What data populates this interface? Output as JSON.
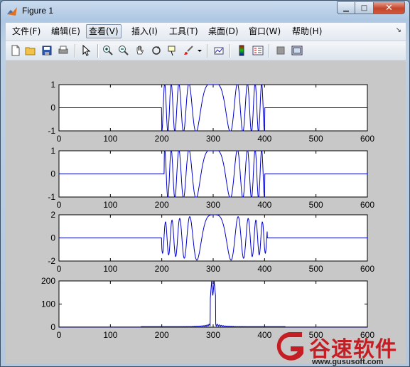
{
  "window": {
    "title": "Figure 1",
    "buttons": {
      "minimize": "▁",
      "maximize": "□",
      "close": "✕"
    }
  },
  "menubar": {
    "items": [
      {
        "label": "文件(F)"
      },
      {
        "label": "编辑(E)"
      },
      {
        "label": "查看(V)"
      },
      {
        "label": "插入(I)"
      },
      {
        "label": "工具(T)"
      },
      {
        "label": "桌面(D)"
      },
      {
        "label": "窗口(W)"
      },
      {
        "label": "帮助(H)"
      }
    ],
    "active_item": "查看(V)"
  },
  "toolbar": {
    "icons": [
      "new-figure-icon",
      "open-file-icon",
      "save-icon",
      "print-icon",
      "pointer-icon",
      "zoom-in-icon",
      "zoom-out-icon",
      "pan-hand-icon",
      "rotate-3d-icon",
      "data-cursor-icon",
      "brush-icon",
      "brush-dropdown-icon",
      "link-plot-icon",
      "colorbar-icon",
      "legend-icon",
      "hide-plot-tools-icon",
      "show-plot-tools-icon"
    ]
  },
  "watermark": {
    "name": "谷速软件",
    "url": "www.gususoft.com",
    "color": "#c41e24"
  },
  "chart_data": [
    {
      "type": "line",
      "description": "piecewise signal: 0 outside [200,400], cos oscillation inside",
      "x_ticks": [
        "0",
        "100",
        "200",
        "300",
        "400",
        "500",
        "600"
      ],
      "y_ticks": [
        "1",
        "0",
        "-1"
      ],
      "xlim": [
        0,
        600
      ],
      "ylim": [
        -1,
        1
      ],
      "series": [
        {
          "kind": "chirp-cos",
          "support": [
            200,
            400
          ],
          "amplitude": 1,
          "color": "#0000cc"
        }
      ]
    },
    {
      "type": "line",
      "description": "piecewise signal: 0 outside [200,400], cos oscillation inside",
      "x_ticks": [
        "0",
        "100",
        "200",
        "300",
        "400",
        "500",
        "600"
      ],
      "y_ticks": [
        "1",
        "0",
        "-1"
      ],
      "xlim": [
        0,
        600
      ],
      "ylim": [
        -1,
        1
      ],
      "series": [
        {
          "kind": "chirp-cos",
          "support": [
            205,
            400
          ],
          "amplitude": 1,
          "color": "#0000cc"
        }
      ]
    },
    {
      "type": "line",
      "description": "sum of two chirp signals",
      "x_ticks": [
        "0",
        "100",
        "200",
        "300",
        "400",
        "500",
        "600"
      ],
      "y_ticks": [
        "2",
        "0",
        "-2"
      ],
      "xlim": [
        0,
        600
      ],
      "ylim": [
        -2,
        2
      ],
      "series": [
        {
          "kind": "chirp-sum",
          "support": [
            200,
            405
          ],
          "amplitude": 2,
          "color": "#0000cc"
        }
      ]
    },
    {
      "type": "line",
      "description": "magnitude spectrum with sharp peak near 300",
      "x_ticks": [
        "0",
        "100",
        "200",
        "300",
        "400",
        "500",
        "600"
      ],
      "y_ticks": [
        "200",
        "100",
        "0"
      ],
      "xlim": [
        0,
        600
      ],
      "ylim": [
        0,
        200
      ],
      "series": [
        {
          "kind": "spectrum",
          "peak_x": 300,
          "peak_y": 200,
          "color": "#0000cc"
        }
      ]
    }
  ]
}
